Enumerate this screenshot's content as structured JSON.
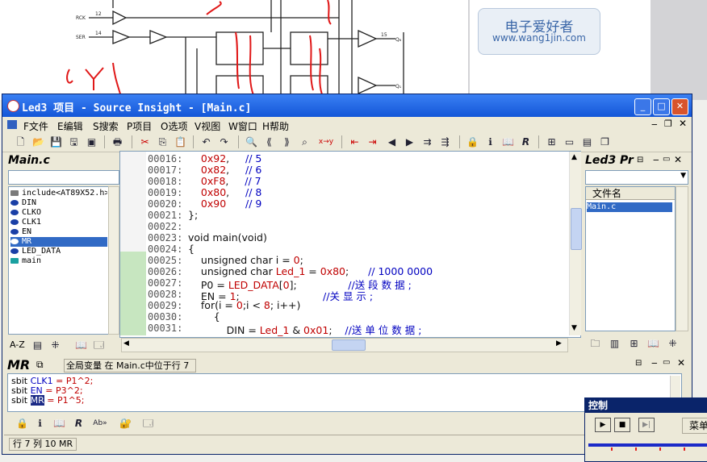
{
  "background": {
    "logo_title": "电子爱好者",
    "logo_url": "www.wang1jin.com",
    "pin_labels": [
      "RCK",
      "SER"
    ],
    "pin_numbers": [
      "12",
      "14",
      "15"
    ],
    "output_labels": [
      "Q₆",
      "Q₁"
    ]
  },
  "window": {
    "title": "Led3 项目 - Source Insight - [Main.c]",
    "buttons": {
      "minimize": "_",
      "maximize": "□",
      "close": "✕"
    }
  },
  "menu": {
    "items": [
      "F文件",
      "E编辑",
      "S搜索",
      "P项目",
      "O选项",
      "V视图",
      "W窗口",
      "H帮助"
    ]
  },
  "symbol_pane": {
    "file_name": "Main.c",
    "symbols": [
      "include<AT89X52.h>",
      "DIN",
      "CLKO",
      "CLK1",
      "EN",
      "MR",
      "LED_DATA",
      "main"
    ],
    "selected_index": 5,
    "sort_label": "A-Z"
  },
  "editor": {
    "lines": [
      {
        "n": "00016:",
        "code": "    0x92,     // 5"
      },
      {
        "n": "00017:",
        "code": "    0x82,     // 6"
      },
      {
        "n": "00018:",
        "code": "    0xF8,     // 7"
      },
      {
        "n": "00019:",
        "code": "    0x80,     // 8"
      },
      {
        "n": "00020:",
        "code": "    0x90      // 9"
      },
      {
        "n": "00021:",
        "code": "};"
      },
      {
        "n": "00022:",
        "code": ""
      },
      {
        "n": "00023:",
        "code": "void main(void)"
      },
      {
        "n": "00024:",
        "code": "{"
      },
      {
        "n": "00025:",
        "code": "    unsigned char i = 0;"
      },
      {
        "n": "00026:",
        "code": "    unsigned char Led_1 = 0x80;      // 1000 0000"
      },
      {
        "n": "00027:",
        "code": "    P0 = LED_DATA[0];                //送 段 数 据 ;"
      },
      {
        "n": "00028:",
        "code": "    EN = 1;                          //关 显 示 ;"
      },
      {
        "n": "00029:",
        "code": "    for(i = 0;i < 8; i++)"
      },
      {
        "n": "00030:",
        "code": "        {"
      },
      {
        "n": "00031:",
        "code": "            DIN = Led_1 & 0x01;    //送 单 位 数 据 ;"
      }
    ]
  },
  "project_pane": {
    "title": "Led3 Pr",
    "column_header": "文件名",
    "files": [
      "Main.c"
    ]
  },
  "context_pane": {
    "symbol": "MR",
    "info": "全局变量 在 Main.c中位于行 7",
    "lines": [
      {
        "pre": "sbit ",
        "name": "CLK1",
        "post": " = P1^2;"
      },
      {
        "pre": "sbit ",
        "name": "EN",
        "post": " = P3^2;"
      },
      {
        "pre": "sbit ",
        "name": "MR",
        "post": " = P1^5;"
      }
    ]
  },
  "status": {
    "text": "行 7  列 10    MR"
  },
  "control_window": {
    "title": "控制",
    "menu_label": "菜单"
  },
  "colors": {
    "titlebar": "#1356d8",
    "selection": "#316ac5",
    "keyword_number": "#c00000",
    "comment": "#0000c0"
  }
}
